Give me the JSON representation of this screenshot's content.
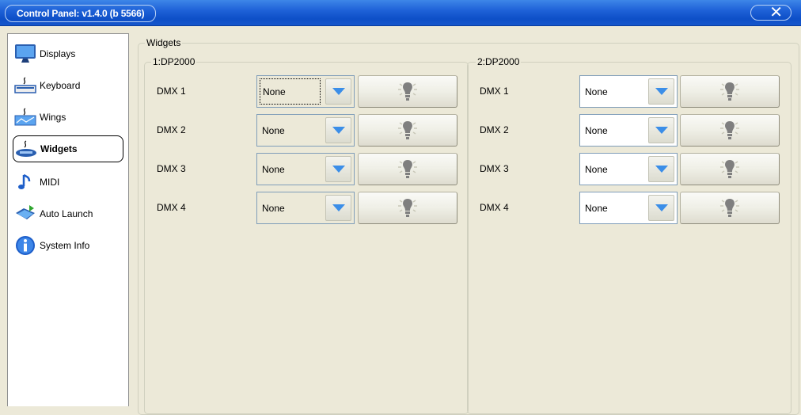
{
  "window": {
    "title": "Control Panel: v1.4.0 (b 5566)",
    "close_glyph": "✕"
  },
  "sidebar": {
    "items": [
      {
        "label": "Displays",
        "icon": "monitor-icon"
      },
      {
        "label": "Keyboard",
        "icon": "keyboard-icon"
      },
      {
        "label": "Wings",
        "icon": "wing-icon"
      },
      {
        "label": "Widgets",
        "icon": "widget-icon",
        "selected": true
      },
      {
        "label": "MIDI",
        "icon": "music-note-icon"
      },
      {
        "label": "Auto Launch",
        "icon": "auto-launch-icon"
      },
      {
        "label": "System Info",
        "icon": "info-icon"
      }
    ]
  },
  "main": {
    "group_title": "Widgets",
    "devices": [
      {
        "title": "1:DP2000",
        "rows": [
          {
            "label": "DMX 1",
            "value": "None"
          },
          {
            "label": "DMX 2",
            "value": "None"
          },
          {
            "label": "DMX 3",
            "value": "None"
          },
          {
            "label": "DMX 4",
            "value": "None"
          }
        ]
      },
      {
        "title": "2:DP2000",
        "rows": [
          {
            "label": "DMX 1",
            "value": "None"
          },
          {
            "label": "DMX 2",
            "value": "None"
          },
          {
            "label": "DMX 3",
            "value": "None"
          },
          {
            "label": "DMX 4",
            "value": "None"
          }
        ]
      }
    ]
  },
  "colors": {
    "titlebar": "#1f62d8",
    "background": "#ece9d8",
    "dropdown_arrow": "#3b8ee8"
  }
}
